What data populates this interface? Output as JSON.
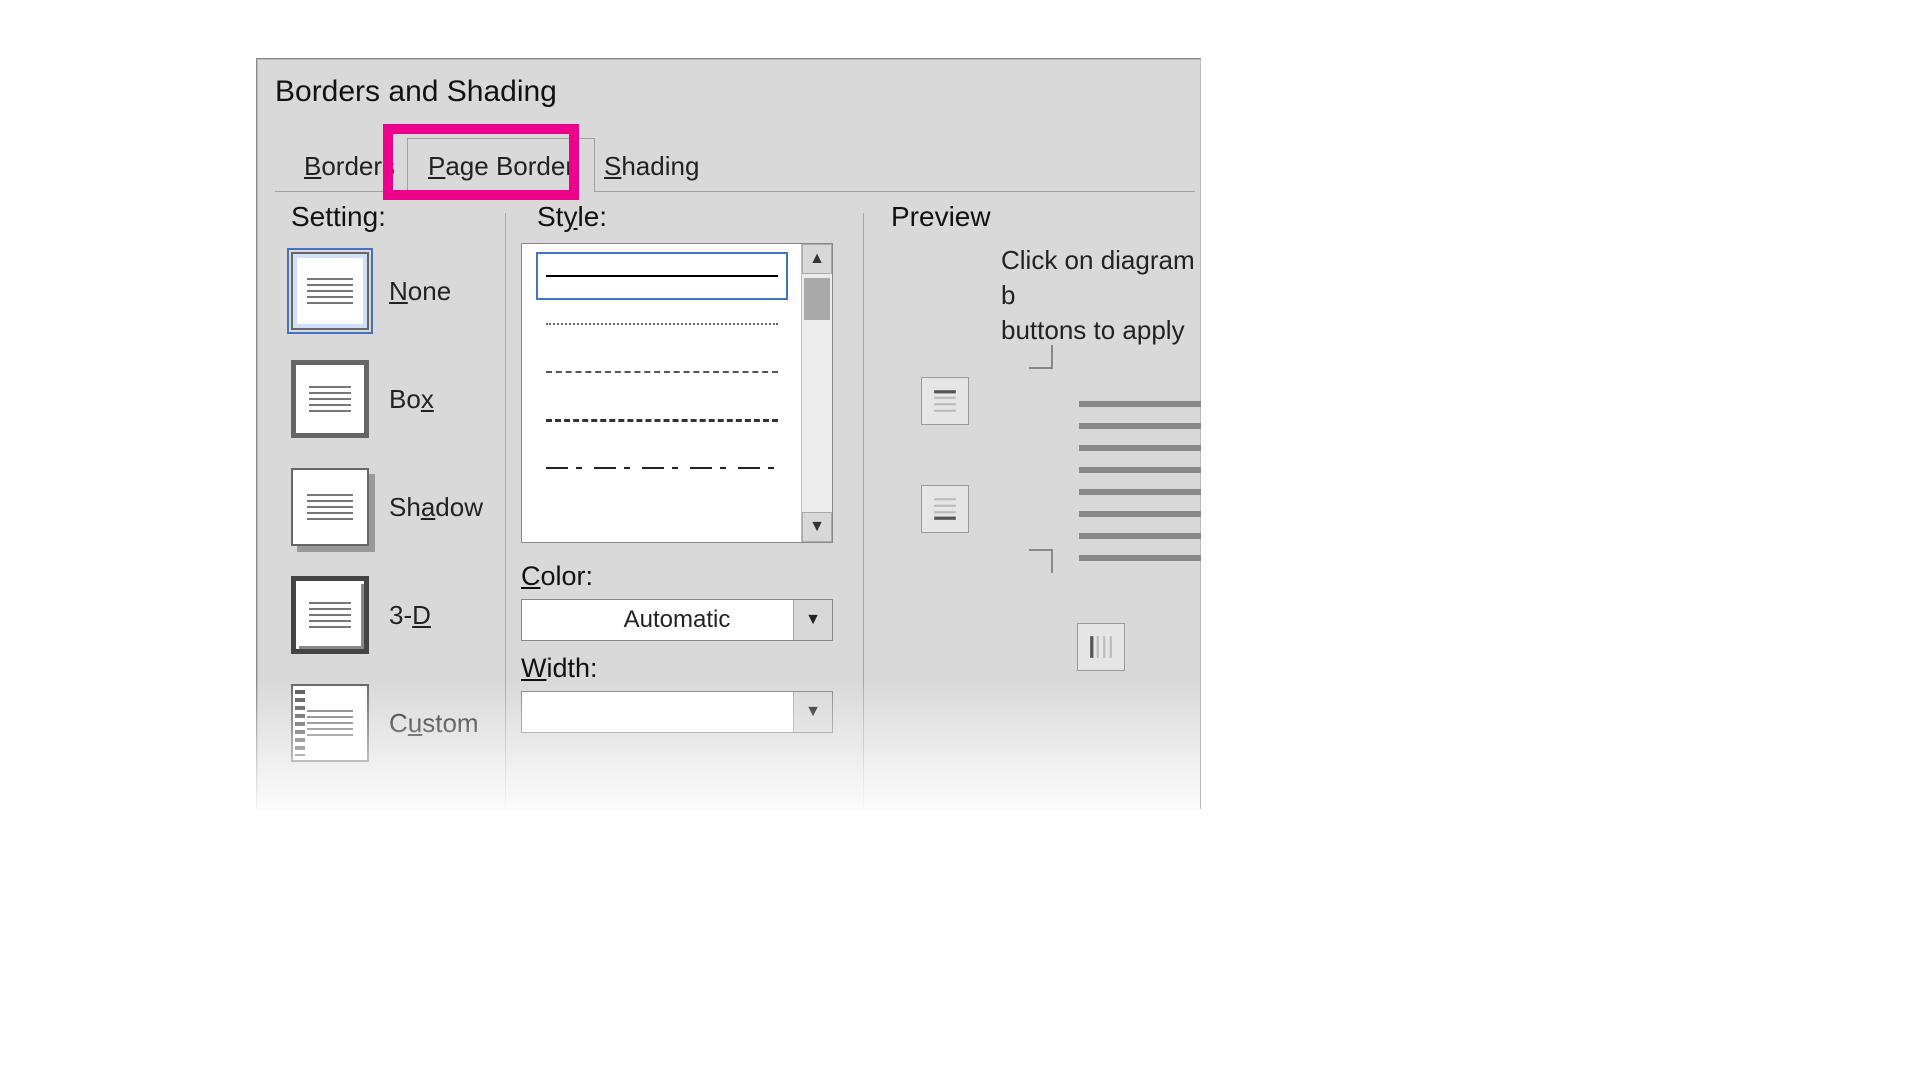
{
  "dialog": {
    "title": "Borders and Shading"
  },
  "tabs": {
    "borders": "Borders",
    "page_border": "Page Border",
    "shading": "Shading",
    "active": "page_border"
  },
  "setting": {
    "label": "Setting:",
    "options": [
      {
        "id": "none",
        "label": "None"
      },
      {
        "id": "box",
        "label": "Box"
      },
      {
        "id": "shadow",
        "label": "Shadow"
      },
      {
        "id": "3d",
        "label": "3-D"
      },
      {
        "id": "custom",
        "label": "Custom"
      }
    ],
    "selected": "none"
  },
  "style": {
    "label": "Style:",
    "options": [
      "solid",
      "dotted",
      "dashed-short",
      "dashed-long",
      "dash-dot"
    ],
    "selected": "solid"
  },
  "color": {
    "label": "Color:",
    "value": "Automatic"
  },
  "width": {
    "label": "Width:"
  },
  "preview": {
    "label": "Preview",
    "hint1": "Click on diagram b",
    "hint2": "buttons to apply"
  },
  "highlight_color": "#ec008c"
}
